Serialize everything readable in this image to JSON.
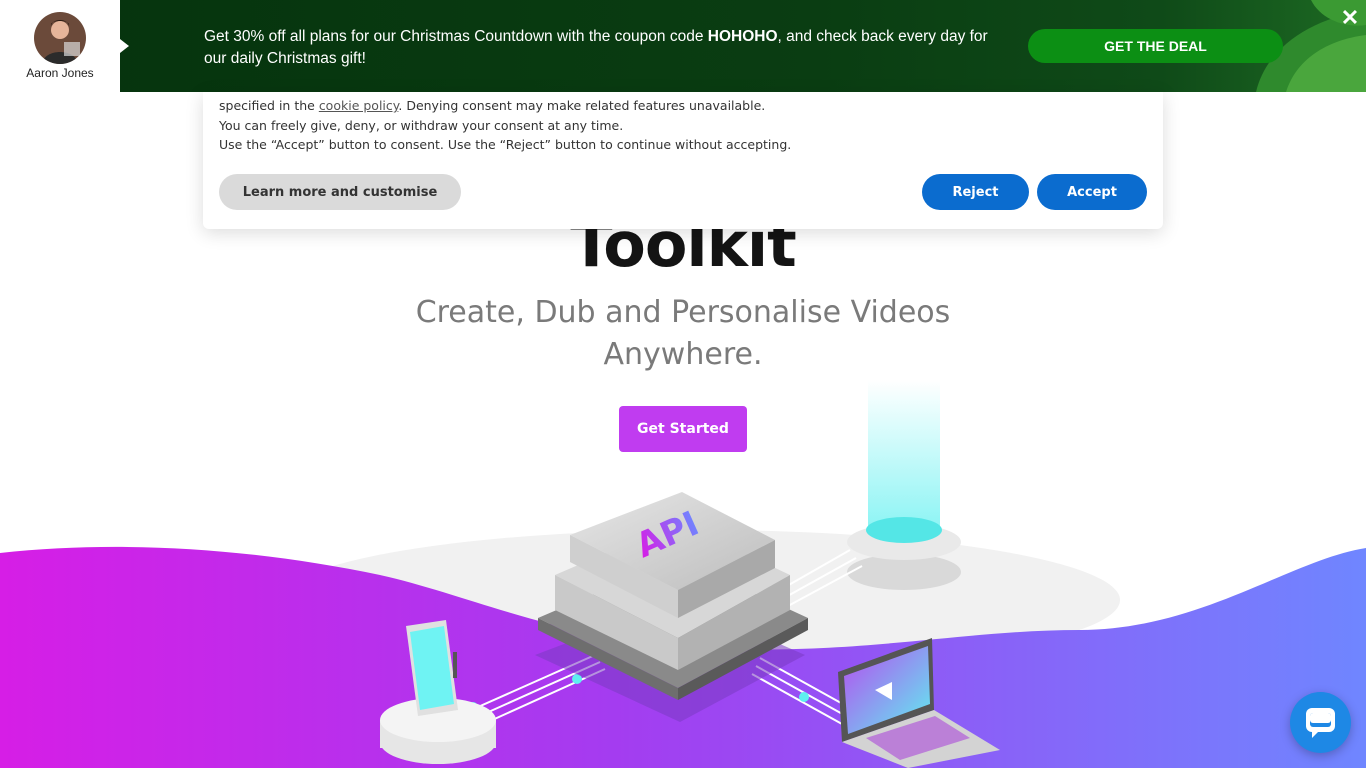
{
  "promo": {
    "profile_name": "Aaron Jones",
    "text_part1": "Get 30% off all plans for our Christmas Countdown with the coupon code ",
    "coupon_code": "HOHOHO",
    "text_part2": ", and check back every day for our daily Christmas gift!",
    "cta_label": "GET THE DEAL",
    "close_label": "✕"
  },
  "consent": {
    "line1_before_link": "specified in the ",
    "line1_link": "cookie policy",
    "line1_after_link": ". Denying consent may make related features unavailable.",
    "line2": "You can freely give, deny, or withdraw your consent at any time.",
    "line3": "Use the “Accept” button to consent. Use the “Reject” button to continue without accepting.",
    "learn_more_label": "Learn more and customise",
    "reject_label": "Reject",
    "accept_label": "Accept"
  },
  "hero": {
    "title": "Toolkit",
    "subtitle": "Create, Dub and Personalise Videos Anywhere.",
    "cta_label": "Get Started"
  },
  "illustration": {
    "chip_label": "API"
  },
  "colors": {
    "promo_bg": "#05330d",
    "deal_button": "#0c8f14",
    "consent_button": "#0b6ccf",
    "cta_purple": "#c03cf0",
    "wave_left": "#d61ee6",
    "wave_right": "#6f86ff",
    "chat_blue": "#1e88e5"
  },
  "icons": {
    "close": "close-icon",
    "chat": "chat-bubble-icon"
  }
}
